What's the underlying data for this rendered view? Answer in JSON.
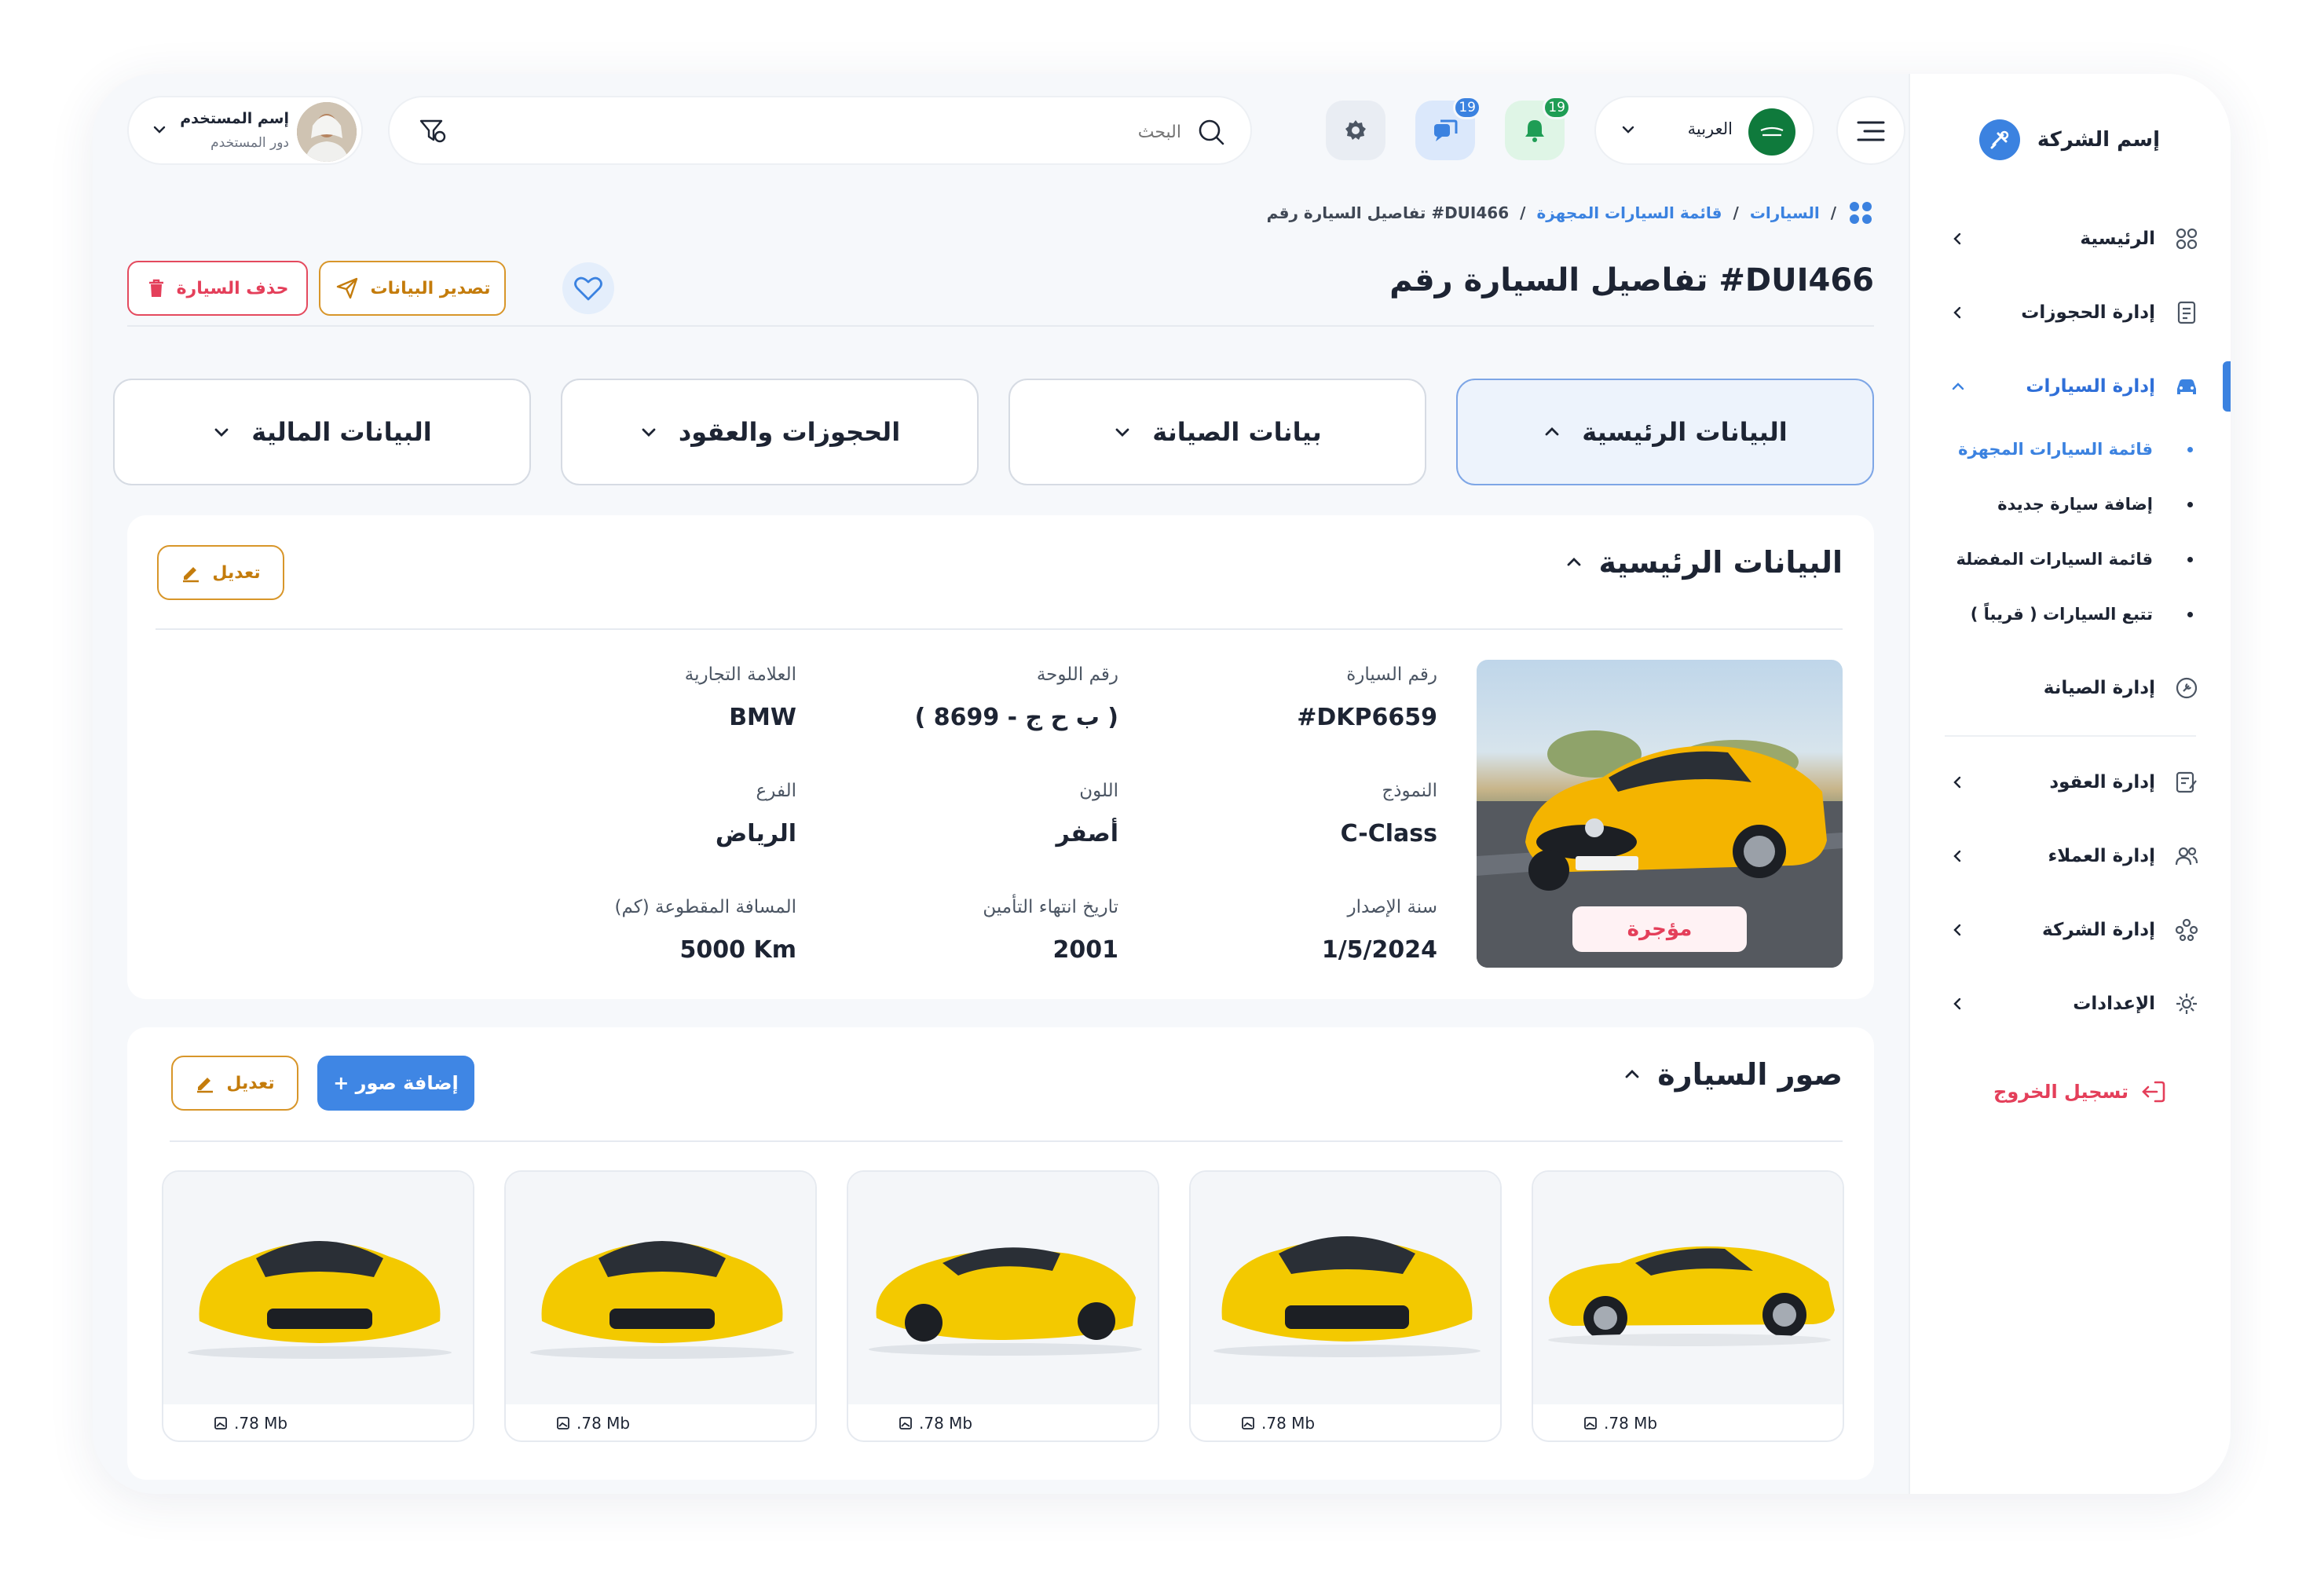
{
  "sidebar": {
    "brand": "إسم الشركة",
    "items": [
      {
        "label": "الرئيسية"
      },
      {
        "label": "إدارة الحجوزات"
      },
      {
        "label": "إدارة السيارات"
      },
      {
        "label": "إدارة الصيانة"
      },
      {
        "label": "إدارة العقود"
      },
      {
        "label": "إدارة العملاء"
      },
      {
        "label": "إدارة الشركة"
      },
      {
        "label": "الإعدادات"
      }
    ],
    "subitems": [
      {
        "label": "قائمة السيارات المجهزة"
      },
      {
        "label": "إضافة سيارة جديدة"
      },
      {
        "label": "قائمة السيارات المفضلة"
      },
      {
        "label": "تتبع السيارات ( قريباً )"
      }
    ],
    "logout": "تسجيل الخروج"
  },
  "header": {
    "user_name": "إسم المستخدم",
    "user_role": "دور المستخدم",
    "search_placeholder": "البحث",
    "messages_badge": "19",
    "notifications_badge": "19",
    "language": "العربية"
  },
  "breadcrumb": [
    "السيارات",
    "قائمة السيارات المجهزة",
    "تفاصيل السيارة رقم #DUI466"
  ],
  "page": {
    "title": "تفاصيل السيارة رقم #DUI466",
    "export_label": "تصدير البيانات",
    "delete_label": "حذف السيارة"
  },
  "tabs": [
    {
      "label": "البيانات الرئيسية",
      "active": true
    },
    {
      "label": "بيانات الصيانة",
      "active": false
    },
    {
      "label": "الحجوزات والعقود",
      "active": false
    },
    {
      "label": "البيانات المالية",
      "active": false
    }
  ],
  "main_info": {
    "heading": "البيانات الرئيسية",
    "edit_label": "تعديل",
    "status": "مؤجرة",
    "fields": [
      {
        "label": "رقم السيارة",
        "value": "#DKP6659"
      },
      {
        "label": "رقم اللوحة",
        "value": "( ب ح ج - 8699 )"
      },
      {
        "label": "العلامة التجارية",
        "value": "BMW"
      },
      {
        "label": "النموذج",
        "value": "C-Class"
      },
      {
        "label": "اللون",
        "value": "أصفر"
      },
      {
        "label": "الفرع",
        "value": "الرياض"
      },
      {
        "label": "سنة الإصدار",
        "value": "1/5/2024"
      },
      {
        "label": "تاريخ انتهاء التأمين",
        "value": "2001"
      },
      {
        "label": "المسافة المقطوعة (كم)",
        "value": "5000 Km"
      }
    ]
  },
  "photos": {
    "heading": "صور السيارة",
    "add_label": "+ إضافة صور",
    "edit_label": "تعديل",
    "items": [
      {
        "size": ".78 Mb"
      },
      {
        "size": ".78 Mb"
      },
      {
        "size": ".78 Mb"
      },
      {
        "size": ".78 Mb"
      },
      {
        "size": ".78 Mb"
      }
    ]
  },
  "colors": {
    "accent": "#3b82e0",
    "danger": "#e43f5a",
    "warning": "#d8962a"
  }
}
